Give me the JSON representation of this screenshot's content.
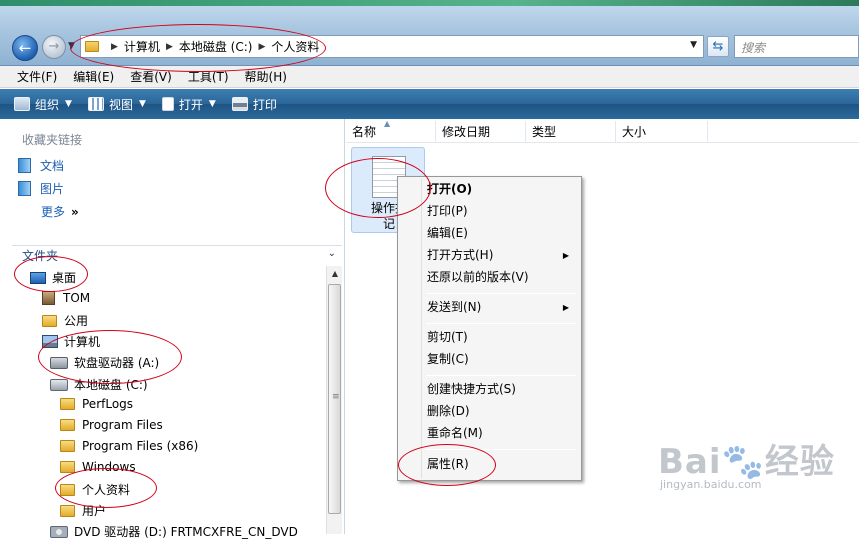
{
  "address": {
    "crumbs": [
      "计算机",
      "本地磁盘 (C:)",
      "个人资料"
    ],
    "search_placeholder": "搜索"
  },
  "menubar": {
    "items": [
      "文件(F)",
      "编辑(E)",
      "查看(V)",
      "工具(T)",
      "帮助(H)"
    ]
  },
  "toolbar": {
    "organize": "组织",
    "views": "视图",
    "open": "打开",
    "print": "打印"
  },
  "navpane": {
    "favorites_title": "收藏夹链接",
    "favorites": [
      "文档",
      "图片",
      "更多"
    ],
    "folders_title": "文件夹",
    "tree": [
      "桌面",
      "TOM",
      "公用",
      "计算机",
      "软盘驱动器 (A:)",
      "本地磁盘 (C:)",
      "PerfLogs",
      "Program Files",
      "Program Files (x86)",
      "Windows",
      "个人资料",
      "用户",
      "DVD 驱动器 (D:) FRTMCXFRE_CN_DVD"
    ]
  },
  "filepane": {
    "columns": [
      "名称",
      "修改日期",
      "类型",
      "大小"
    ],
    "file_name_line1": "操作指",
    "file_name_line2": "记"
  },
  "context_menu": {
    "items": [
      "打开(O)",
      "打印(P)",
      "编辑(E)",
      "打开方式(H)",
      "还原以前的版本(V)",
      "发送到(N)",
      "剪切(T)",
      "复制(C)",
      "创建快捷方式(S)",
      "删除(D)",
      "重命名(M)",
      "属性(R)"
    ]
  },
  "watermark": {
    "logo": "Bai🐾经验",
    "url": "jingyan.baidu.com"
  },
  "colors": {
    "toolbar": "#2a6597",
    "annotation": "#d0021b",
    "link": "#1a5fb4"
  }
}
